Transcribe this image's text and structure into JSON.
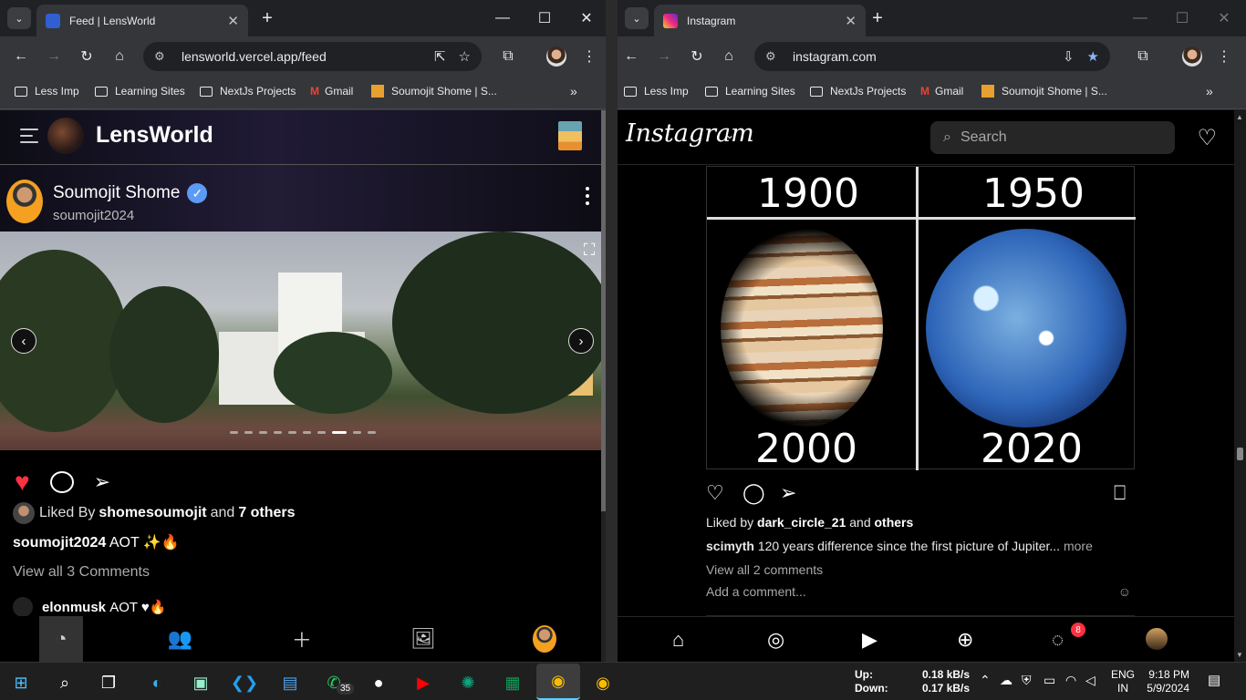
{
  "left_window": {
    "tab_title": "Feed | LensWorld",
    "url": "lensworld.vercel.app/feed",
    "bookmarks": [
      "Less Imp",
      "Learning Sites",
      "NextJs Projects",
      "Gmail",
      "Soumojit Shome | S..."
    ],
    "site": {
      "brand": "LensWorld",
      "post": {
        "author_name": "Soumojit Shome",
        "author_handle": "soumojit2024",
        "verified": true,
        "slide_count": 10,
        "active_slide": 8,
        "liked": true,
        "liked_by_prefix": "Liked By",
        "liked_by_user": "shomesoumojit",
        "liked_by_and": "and",
        "liked_by_others": "7 others",
        "caption_user": "soumojit2024",
        "caption_text": "AOT ✨🔥",
        "view_all_comments": "View all 3 Comments",
        "comment_user": "elonmusk",
        "comment_text": "AOT ♥🔥"
      },
      "bottom_nav": [
        "feed-icon",
        "friends-icon",
        "add-icon",
        "gallery-icon",
        "profile-avatar"
      ]
    }
  },
  "right_window": {
    "tab_title": "Instagram",
    "url": "instagram.com",
    "bookmarks": [
      "Less Imp",
      "Learning Sites",
      "NextJs Projects",
      "Gmail",
      "Soumojit Shome | S..."
    ],
    "site": {
      "logo": "Instagram",
      "search_placeholder": "Search",
      "post_image_labels": [
        "1900",
        "1950",
        "2000",
        "2020"
      ],
      "liked_by_prefix": "Liked by",
      "liked_by_user": "dark_circle_21",
      "liked_by_and": "and",
      "liked_by_others": "others",
      "caption_user": "scimyth",
      "caption_text": "120 years difference since the first picture of Jupiter...",
      "caption_more": "more",
      "view_all_comments": "View all 2 comments",
      "add_comment_placeholder": "Add a comment...",
      "messages_badge": "8"
    }
  },
  "taskbar": {
    "apps": [
      "start",
      "search",
      "task-view",
      "edge",
      "photos",
      "vscode",
      "file-explorer",
      "whatsapp",
      "github",
      "youtube",
      "chatgpt",
      "google-classroom",
      "chrome",
      "chrome"
    ],
    "whatsapp_badge": "35",
    "net_up_label": "Up:",
    "net_down_label": "Down:",
    "net_up": "0.18 kB/s",
    "net_down": "0.17 kB/s",
    "lang": "ENG",
    "region": "IN",
    "time": "9:18 PM",
    "date": "5/9/2024"
  }
}
